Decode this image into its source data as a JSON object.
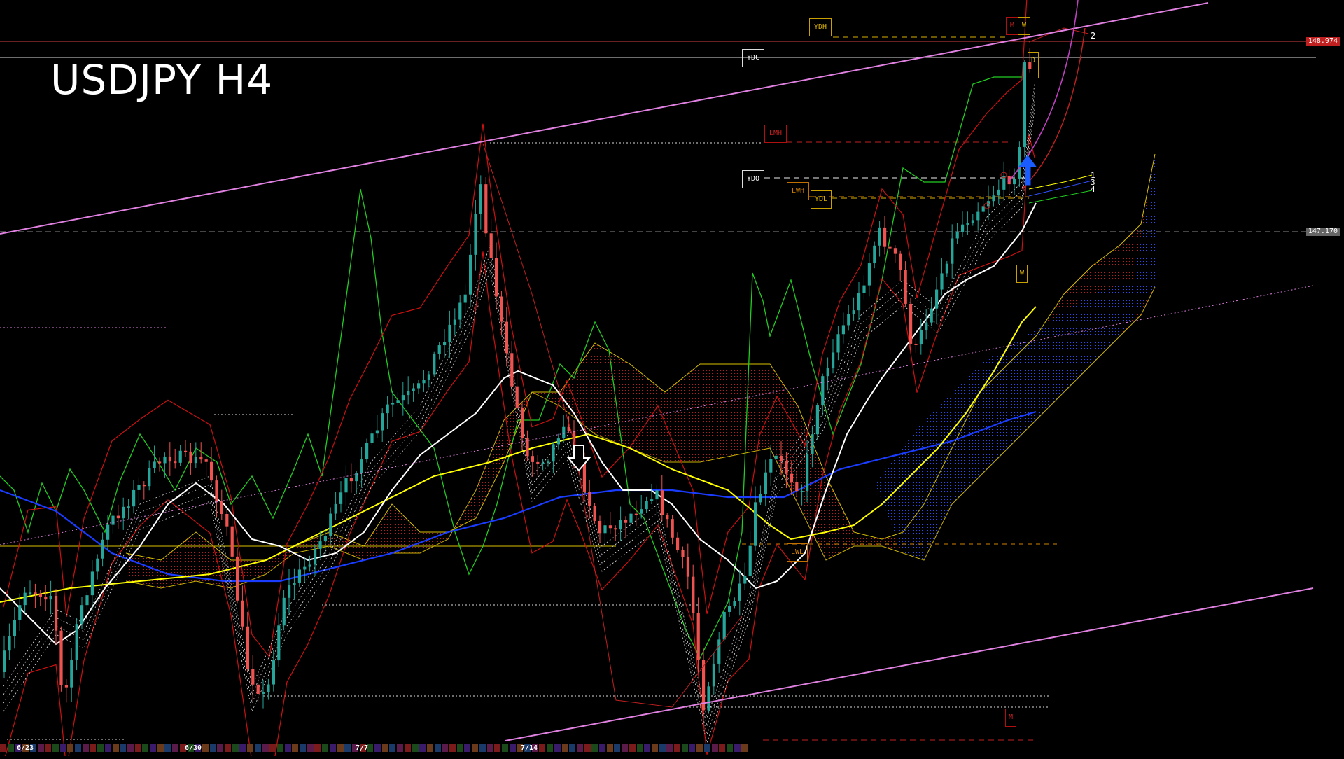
{
  "title": "USDJPY H4",
  "colors": {
    "background": "#000000",
    "bull": "#26a69a",
    "bear": "#ef5350",
    "channel": "#e080e0",
    "ma_white": "#ffffff",
    "ma_yellow": "#ffff00",
    "ma_blue": "#1a3cff",
    "rsi_green": "#22cc22",
    "bband_red": "#cc1111"
  },
  "price_tags": {
    "upper": "148.974",
    "mid": "147.170"
  },
  "levels": {
    "ydh": "YDH",
    "ydc": "YDC",
    "ydo": "YDO",
    "ydl": "YDL",
    "lmh": "LMH",
    "lwh": "LWH",
    "lwl": "LWL",
    "m_top": "M",
    "w_top": "W",
    "d_mark": "D",
    "w_mid": "W",
    "m_bottom": "M"
  },
  "right_numbers": [
    "2",
    "1",
    "3",
    "4"
  ],
  "dates": [
    "6/23",
    "6/30",
    "7/7",
    "7/14"
  ],
  "chart_data": {
    "type": "candlestick",
    "title": "USDJPY H4",
    "price_labels": [
      148.974,
      147.17
    ],
    "x": [
      "6/23",
      "6/30",
      "7/7",
      "7/14"
    ],
    "horizontal_lines": [
      {
        "name": "YDH",
        "value": "YDH"
      },
      {
        "name": "YDC",
        "value": "YDC"
      },
      {
        "name": "LMH",
        "value": "LMH"
      },
      {
        "name": "YDO",
        "value": "YDO"
      },
      {
        "name": "LWH",
        "value": "LWH"
      },
      {
        "name": "YDL",
        "value": "YDL"
      },
      {
        "name": "LWL",
        "value": "LWL"
      }
    ]
  }
}
